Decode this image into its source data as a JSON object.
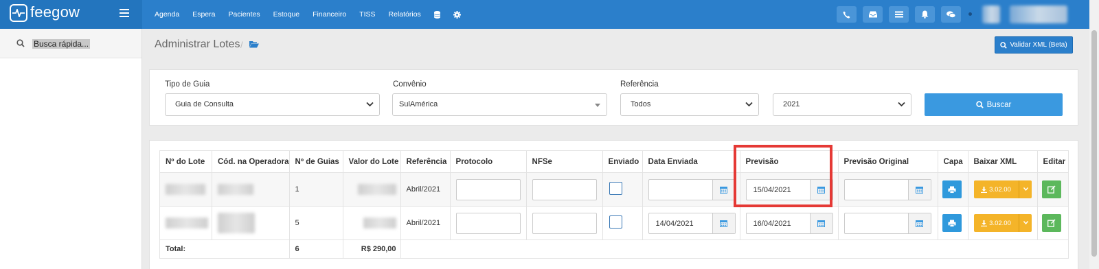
{
  "brand": {
    "name": "feegow"
  },
  "nav": {
    "items": [
      "Agenda",
      "Espera",
      "Pacientes",
      "Estoque",
      "Financeiro",
      "TISS",
      "Relatórios"
    ]
  },
  "sidebar": {
    "quick_search_label": "Busca rápida..."
  },
  "page": {
    "title": "Administrar Lotes",
    "breadcrumb_sep": "/",
    "validate_button": "Validar XML (Beta)"
  },
  "filters": {
    "tipo_label": "Tipo de Guia",
    "tipo_value": "Guia de Consulta",
    "convenio_label": "Convênio",
    "convenio_value": "SulAmérica",
    "referencia_label": "Referência",
    "referencia_month": "Todos",
    "referencia_year": "2021",
    "search_button": "Buscar"
  },
  "table": {
    "headers": [
      "Nº do Lote",
      "Cód. na Operadora",
      "Nº de Guias",
      "Valor do Lote",
      "Referência",
      "Protocolo",
      "NFSe",
      "Enviado",
      "Data Enviada",
      "Previsão",
      "Previsão Original",
      "Capa",
      "Baixar XML",
      "Editar"
    ],
    "rows": [
      {
        "guias": "1",
        "referencia": "Abril/2021",
        "data_enviada": "",
        "previsao": "15/04/2021",
        "xml_version": "3.02.00"
      },
      {
        "guias": "5",
        "referencia": "Abril/2021",
        "data_enviada": "14/04/2021",
        "previsao": "16/04/2021",
        "xml_version": "3.02.00"
      }
    ],
    "total": {
      "label": "Total:",
      "guias": "6",
      "valor": "R$ 290,00"
    }
  },
  "colors": {
    "navbar": "#2b7fcb",
    "highlight": "#e53935",
    "xml_button": "#f4b429",
    "edit_button": "#5cb85c",
    "capa_button": "#2f99dc"
  }
}
